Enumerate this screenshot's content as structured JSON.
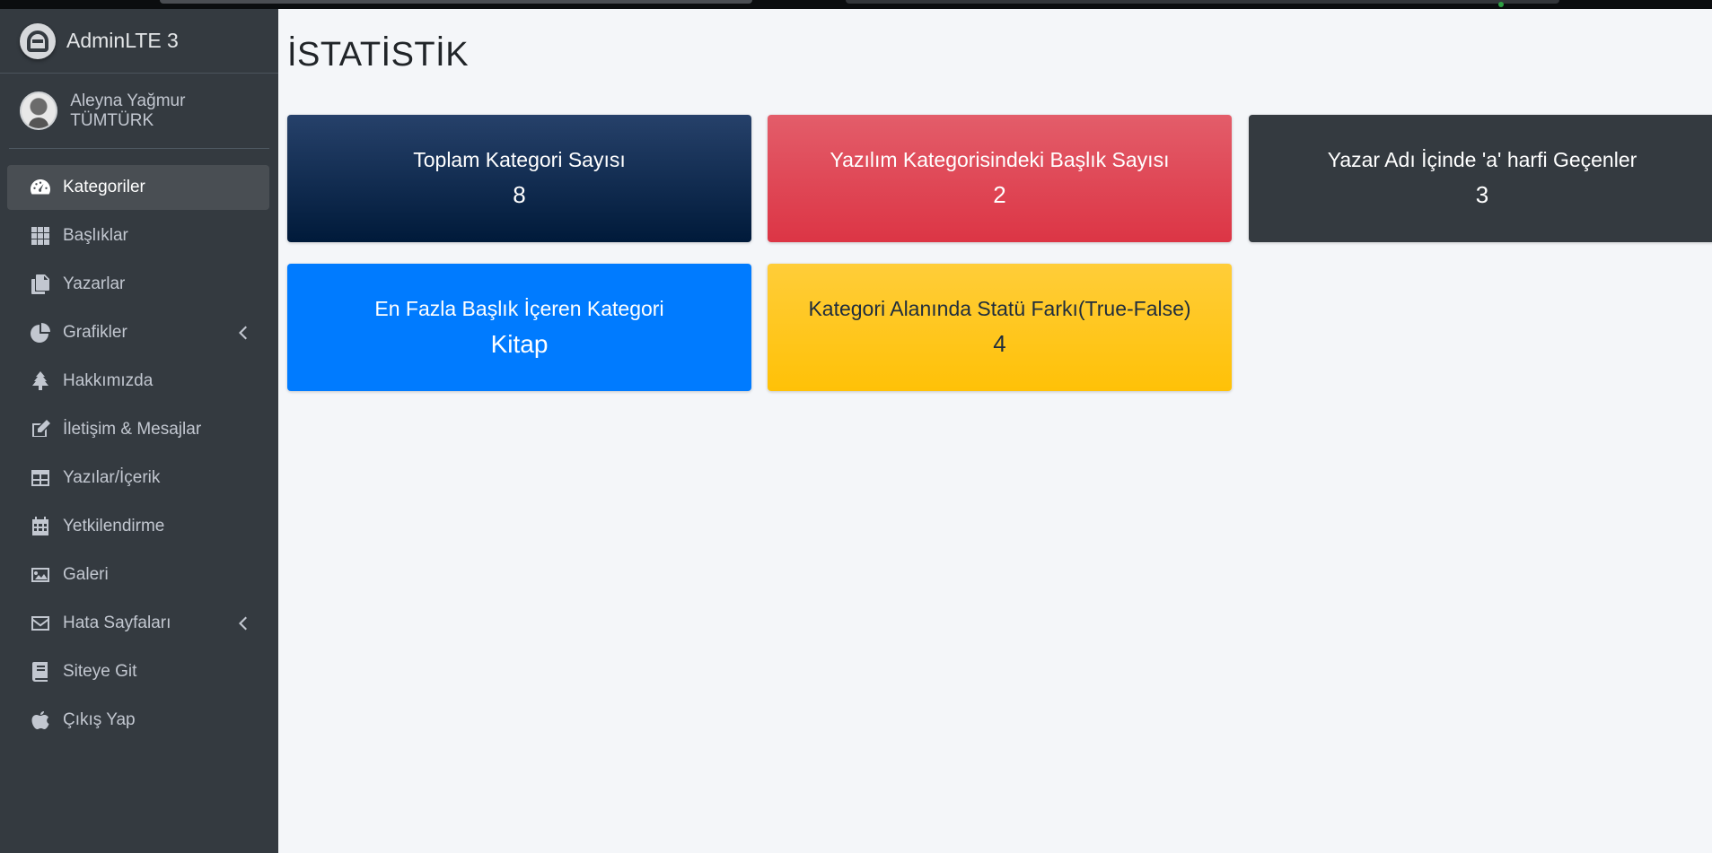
{
  "brand": {
    "name": "AdminLTE 3"
  },
  "user": {
    "name": "Aleyna Yağmur TÜMTÜRK"
  },
  "sidebar": {
    "items": [
      {
        "label": "Kategoriler",
        "icon": "tachometer-icon",
        "active": true
      },
      {
        "label": "Başlıklar",
        "icon": "grid-icon"
      },
      {
        "label": "Yazarlar",
        "icon": "copy-icon"
      },
      {
        "label": "Grafikler",
        "icon": "pie-chart-icon",
        "has_submenu": true
      },
      {
        "label": "Hakkımızda",
        "icon": "tree-icon"
      },
      {
        "label": "İletişim & Mesajlar",
        "icon": "edit-icon"
      },
      {
        "label": "Yazılar/İçerik",
        "icon": "table-icon"
      },
      {
        "label": "Yetkilendirme",
        "icon": "calendar-icon"
      },
      {
        "label": "Galeri",
        "icon": "image-icon"
      },
      {
        "label": "Hata Sayfaları",
        "icon": "envelope-icon",
        "has_submenu": true
      },
      {
        "label": "Siteye Git",
        "icon": "book-icon"
      },
      {
        "label": "Çıkış Yap",
        "icon": "apple-icon"
      }
    ]
  },
  "main": {
    "title": "İSTATİSTİK",
    "boxes": [
      {
        "label": "Toplam Kategori Sayısı",
        "value": "8",
        "color": "#001f3f"
      },
      {
        "label": "Yazılım Kategorisindeki Başlık Sayısı",
        "value": "2",
        "color": "#dc3545"
      },
      {
        "label": "Yazar Adı İçinde 'a' harfi Geçenler",
        "value": "3",
        "color": "#343a40"
      },
      {
        "label": "En Fazla Başlık İçeren Kategori",
        "value": "Kitap",
        "color": "#007bff"
      },
      {
        "label": "Kategori Alanında Statü Farkı(True-False)",
        "value": "4",
        "color": "#ffc107"
      }
    ]
  },
  "colors": {
    "sidebar_bg": "#343a40",
    "content_bg": "#f4f6f9",
    "accent": "#007bff"
  }
}
